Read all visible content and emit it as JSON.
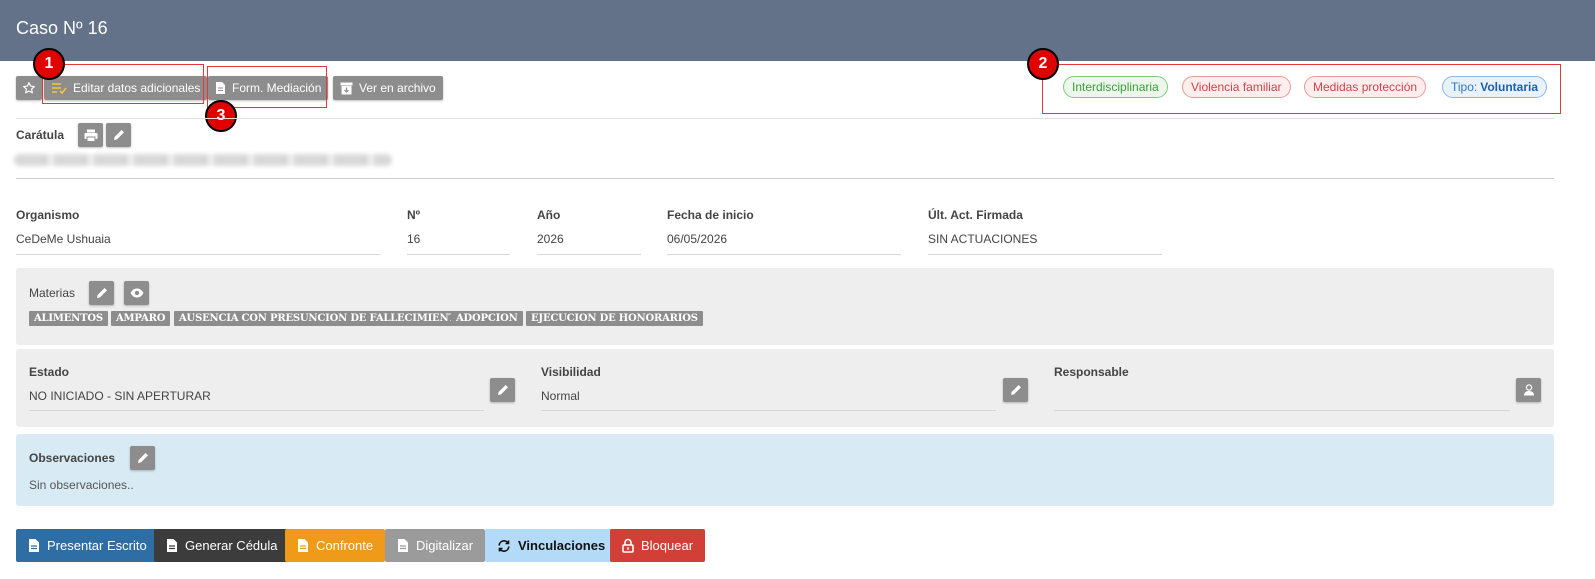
{
  "header": {
    "title": "Caso Nº 16"
  },
  "toolbar": {
    "star_icon": "star-icon",
    "editar_label": "Editar datos adicionales",
    "form_mediacion_label": "Form. Mediación",
    "ver_archivo_label": "Ver en archivo"
  },
  "callouts": [
    "1",
    "2",
    "3"
  ],
  "tags": {
    "interdisciplinaria": "Interdisciplinaria",
    "violencia": "Violencia familiar",
    "medidas": "Medidas protección",
    "tipo_label": "Tipo:",
    "tipo_value": "Voluntaria"
  },
  "caratula": {
    "label": "Carátula"
  },
  "fields": {
    "organismo": {
      "label": "Organismo",
      "value": "CeDeMe Ushuaia"
    },
    "numero": {
      "label": "Nº",
      "value": "16"
    },
    "anio": {
      "label": "Año",
      "value": "2026"
    },
    "fecha_inicio": {
      "label": "Fecha de inicio",
      "value": "06/05/2026"
    },
    "ult_act": {
      "label": "Últ. Act. Firmada",
      "value": "SIN ACTUACIONES"
    }
  },
  "materias": {
    "label": "Materias",
    "items": [
      "ALIMENTOS",
      "AMPARO",
      "AUSENCIA CON PRESUNCION DE FALLECIMIENTO",
      "ADOPCION",
      "EJECUCION DE HONORARIOS"
    ]
  },
  "estado": {
    "label": "Estado",
    "value": "NO INICIADO - SIN APERTURAR"
  },
  "visibilidad": {
    "label": "Visibilidad",
    "value": "Normal"
  },
  "responsable": {
    "label": "Responsable",
    "value": ""
  },
  "observaciones": {
    "label": "Observaciones",
    "value": "Sin observaciones.."
  },
  "actions": {
    "presentar": "Presentar Escrito",
    "generar": "Generar Cédula",
    "confronte": "Confronte",
    "digitalizar": "Digitalizar",
    "vinculaciones": "Vinculaciones",
    "bloquear": "Bloquear"
  },
  "colors": {
    "header": "#637289",
    "button_gray": "#8d8d8d",
    "primary": "#2f6ea5",
    "dark": "#3c3c3c",
    "warning": "#f09a1a",
    "info_light": "#b3daf7",
    "danger": "#d13f36",
    "callout_red": "#e00000"
  }
}
